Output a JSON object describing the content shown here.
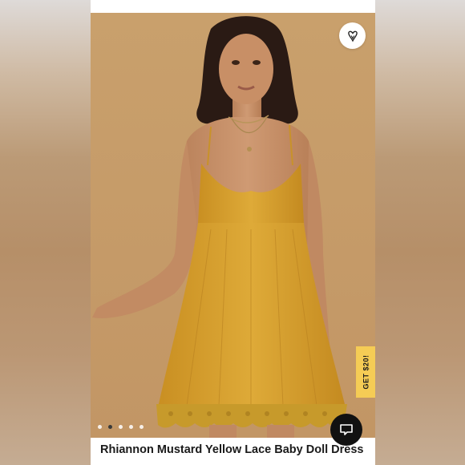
{
  "product": {
    "title": "Rhiannon Mustard Yellow Lace Baby Doll Dress"
  },
  "gallery": {
    "image_count": 5,
    "active_index": 1
  },
  "promo": {
    "label": "GET $20!"
  },
  "icons": {
    "favorite": "heart-logo-icon",
    "chat": "chat-bubble-icon"
  },
  "colors": {
    "dress": "#d9a22f",
    "promo_tab": "#f5cc55",
    "background": "#c79c67"
  }
}
